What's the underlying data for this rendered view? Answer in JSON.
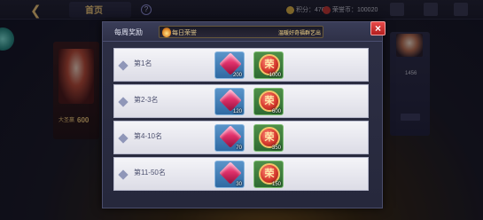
{
  "background": {
    "tab_label": "首页",
    "help": "?",
    "points": "积分：4769",
    "honor": "荣誉币：100020",
    "top_icons": [
      "",
      "",
      ""
    ],
    "left_player": {
      "name": "",
      "title": "大圣赢",
      "score": "600",
      "meta": ""
    },
    "right_player": {
      "name": "",
      "value": "1456",
      "label": "",
      "number": "",
      "meta": ""
    }
  },
  "modal": {
    "title": "每周奖励",
    "tab": {
      "label": "每日荣誉",
      "desc": "温暖好奇福群艺出"
    },
    "close_label": "×",
    "rows": [
      {
        "label": "第1名",
        "rewards": [
          {
            "icon": "gem-icon",
            "qty": "200"
          },
          {
            "icon": "honor-coin-icon",
            "glyph": "荣",
            "qty": "1000"
          }
        ]
      },
      {
        "label": "第2-3名",
        "rewards": [
          {
            "icon": "gem-icon",
            "qty": "120"
          },
          {
            "icon": "honor-coin-icon",
            "glyph": "荣",
            "qty": "600"
          }
        ]
      },
      {
        "label": "第4-10名",
        "rewards": [
          {
            "icon": "gem-icon",
            "qty": "70"
          },
          {
            "icon": "honor-coin-icon",
            "glyph": "荣",
            "qty": "350"
          }
        ]
      },
      {
        "label": "第11-50名",
        "rewards": [
          {
            "icon": "gem-icon",
            "qty": "30"
          },
          {
            "icon": "honor-coin-icon",
            "glyph": "荣",
            "qty": "150"
          }
        ]
      }
    ]
  },
  "colors": {
    "accent_gold": "#e8c27a",
    "close_red": "#d33030",
    "row_bg": "#ececf2",
    "gem_tile": "#4a82bd",
    "coin_tile": "#3f7f3c"
  }
}
